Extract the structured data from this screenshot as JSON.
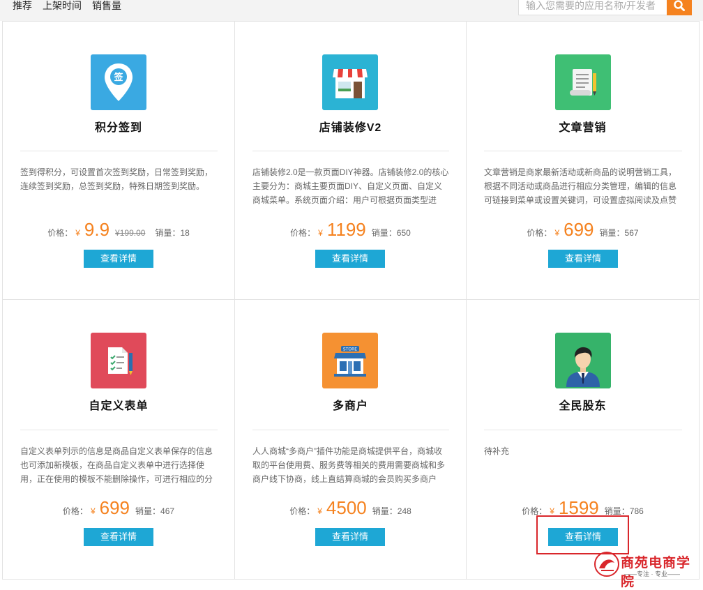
{
  "toolbar": {
    "tabs": [
      "推荐",
      "上架时间",
      "销售量"
    ],
    "search_placeholder": "输入您需要的应用名称/开发者"
  },
  "labels": {
    "price": "价格：",
    "yen": "¥",
    "sales": "销量：",
    "detail_button": "查看详情"
  },
  "colors": {
    "accent": "#f5821f",
    "button": "#1ea7d5",
    "highlight": "#d9262b"
  },
  "apps": [
    {
      "name": "积分签到",
      "icon": "location-pin-icon",
      "icon_color": "#3aa9e2",
      "desc": "签到得积分，可设置首次签到奖励，日常签到奖励，连续签到奖励，总签到奖励，特殊日期签到奖励。",
      "price": "9.9",
      "original_price": "¥199.00",
      "sales": "18"
    },
    {
      "name": "店铺装修V2",
      "icon": "shop-icon",
      "icon_color": "#2bb3d4",
      "desc": "店铺装修2.0是一款页面DIY神器。店铺装修2.0的核心主要分为：商城主要页面DIY、自定义页面、自定义商城菜单。系统页面介绍：用户可根据页面类型进",
      "price": "1199",
      "original_price": "",
      "sales": "650"
    },
    {
      "name": "文章营销",
      "icon": "document-icon",
      "icon_color": "#3fbf74",
      "desc": "文章营销是商家最新活动或新商品的说明营销工具，根据不同活动或商品进行相应分类管理，编辑的信息可链接到菜单或设置关键词，可设置虚拟阅读及点赞",
      "price": "699",
      "original_price": "",
      "sales": "567"
    },
    {
      "name": "自定义表单",
      "icon": "checklist-icon",
      "icon_color": "#e04a5a",
      "desc": "自定义表单列示的信息是商品自定义表单保存的信息也可添加新模板，在商品自定义表单中进行选择使用，正在使用的模板不能删除操作，可进行相应的分",
      "price": "699",
      "original_price": "",
      "sales": "467"
    },
    {
      "name": "多商户",
      "icon": "store-icon",
      "icon_color": "#f59132",
      "desc": "人人商城“多商户”插件功能是商城提供平台，商城收取的平台使用费、服务费等相关的费用需要商城和多商户线下协商，线上直结算商城的会员购买多商户",
      "price": "4500",
      "original_price": "",
      "sales": "248"
    },
    {
      "name": "全民股东",
      "icon": "businessman-icon",
      "icon_color": "#36b36a",
      "desc": "待补充",
      "price": "1599",
      "original_price": "",
      "sales": "786"
    }
  ],
  "watermark": {
    "text": "商苑电商学院",
    "sub": "——专注 · 专业——"
  }
}
